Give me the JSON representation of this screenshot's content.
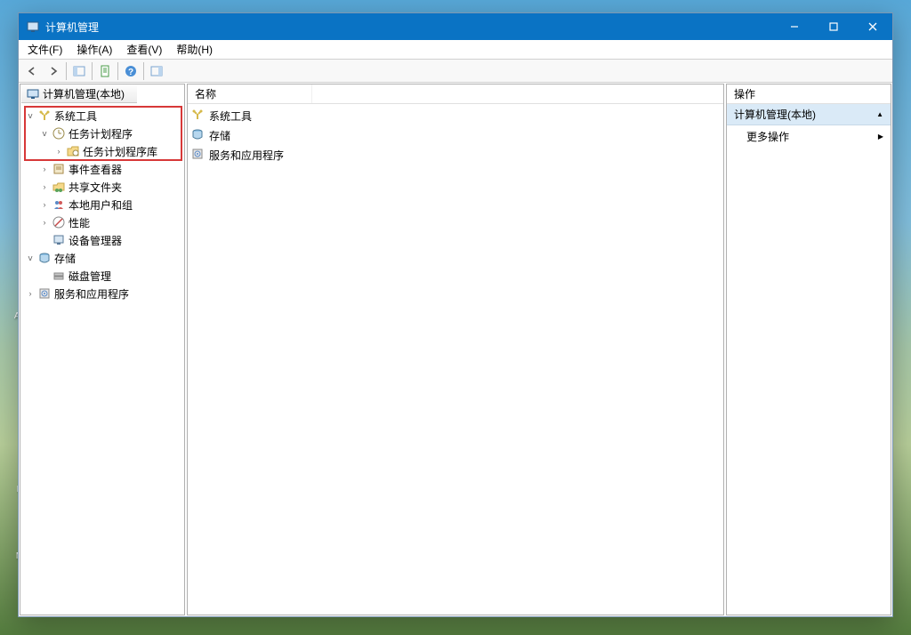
{
  "window": {
    "title": "计算机管理"
  },
  "menu": {
    "file": "文件(F)",
    "action": "操作(A)",
    "view": "查看(V)",
    "help": "帮助(H)"
  },
  "tree": {
    "root": "计算机管理(本地)",
    "system_tools": "系统工具",
    "task_scheduler": "任务计划程序",
    "task_scheduler_library": "任务计划程序库",
    "event_viewer": "事件查看器",
    "shared_folders": "共享文件夹",
    "local_users": "本地用户和组",
    "performance": "性能",
    "device_manager": "设备管理器",
    "storage": "存储",
    "disk_mgmt": "磁盘管理",
    "services_apps": "服务和应用程序"
  },
  "list": {
    "col_name": "名称",
    "items": {
      "system_tools": "系统工具",
      "storage": "存储",
      "services_apps": "服务和应用程序"
    }
  },
  "actions": {
    "header": "操作",
    "group_title": "计算机管理(本地)",
    "more_actions": "更多操作"
  }
}
